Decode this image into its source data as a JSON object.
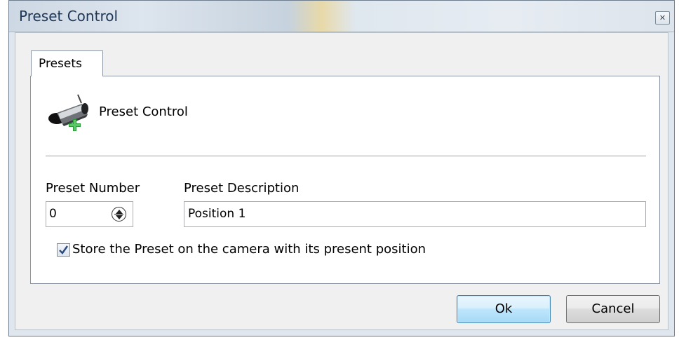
{
  "window": {
    "title": "Preset Control",
    "close_icon": "close-icon"
  },
  "tabs": [
    {
      "label": "Presets",
      "selected": true
    }
  ],
  "header": {
    "icon": "ptz-camera-icon",
    "label": "Preset Control"
  },
  "form": {
    "preset_number_label": "Preset Number",
    "preset_number_value": "0",
    "preset_description_label": "Preset Description",
    "preset_description_value": "Position 1",
    "store_checkbox_label": "Store the Preset on the camera with its present position",
    "store_checkbox_checked": true
  },
  "buttons": {
    "ok": "Ok",
    "cancel": "Cancel"
  }
}
